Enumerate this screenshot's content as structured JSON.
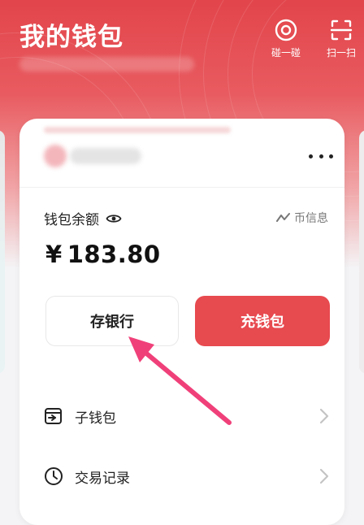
{
  "header": {
    "title": "我的钱包",
    "actions": [
      {
        "icon": "target-icon",
        "label": "碰一碰"
      },
      {
        "icon": "scan-icon",
        "label": "扫一扫"
      }
    ]
  },
  "wallet": {
    "balance_label": "钱包余额",
    "coin_info_label": "币信息",
    "currency_symbol": "¥",
    "amount": "183.80",
    "deposit_button": "存银行",
    "topup_button": "充钱包"
  },
  "menu": {
    "items": [
      {
        "icon": "sub-wallet-icon",
        "label": "子钱包"
      },
      {
        "icon": "clock-icon",
        "label": "交易记录"
      }
    ]
  },
  "colors": {
    "brand_red": "#e74a4f",
    "annotation_arrow": "#f0407a"
  }
}
